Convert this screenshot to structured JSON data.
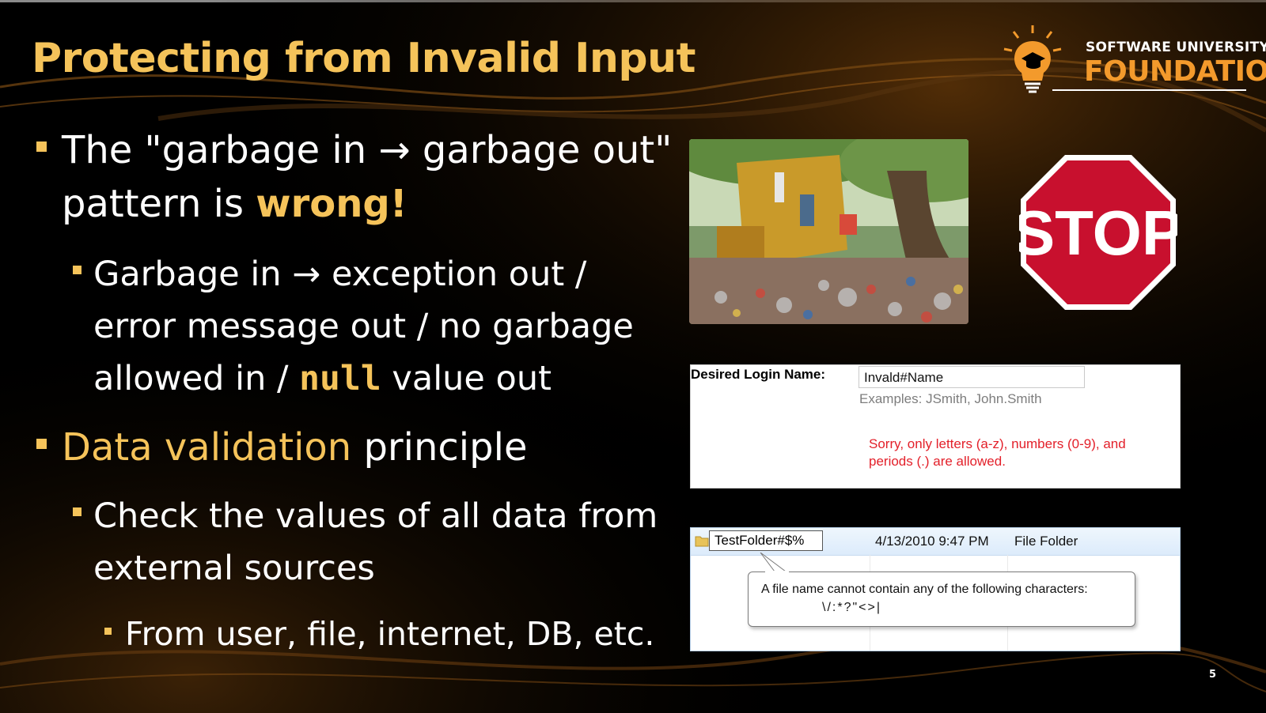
{
  "slide": {
    "title": "Protecting from Invalid Input",
    "page_number": "5"
  },
  "logo": {
    "line1": "SOFTWARE UNIVERSITY",
    "line2": "FOUNDATION"
  },
  "bullets": {
    "b1": {
      "line1": "The \"garbage in → garbage out\"",
      "line2_pre": "pattern is ",
      "line2_em": "wrong!"
    },
    "b2": {
      "line1": "Garbage in → exception out /",
      "line2": "error message out / no garbage",
      "line3_pre": "allowed in / ",
      "line3_code": "null",
      "line3_post": " value out"
    },
    "b3": {
      "em": "Data validation",
      "rest": " principle"
    },
    "b4": {
      "line1": "Check the values of all data from",
      "line2": "external sources"
    },
    "b5": {
      "text": "From user, file, internet, DB, etc."
    }
  },
  "stop_sign": {
    "text": "STOP"
  },
  "login_form": {
    "label": "Desired Login Name:",
    "input_value": "Invald#Name",
    "examples": "Examples: JSmith, John.Smith",
    "error_line1": "Sorry, only letters (a-z), numbers (0-9), and",
    "error_line2": "periods (.) are allowed."
  },
  "explorer": {
    "rename_value": "TestFolder#$%",
    "date": "4/13/2010 9:47 PM",
    "type": "File Folder",
    "tooltip_line1": "A file name cannot contain any of the following characters:",
    "tooltip_line2": "\\/:*?\"<>|"
  },
  "colors": {
    "accent": "#f5c35a",
    "logo_orange": "#f39a2c",
    "error_red": "#e3202a",
    "stop_red": "#c8102e"
  }
}
